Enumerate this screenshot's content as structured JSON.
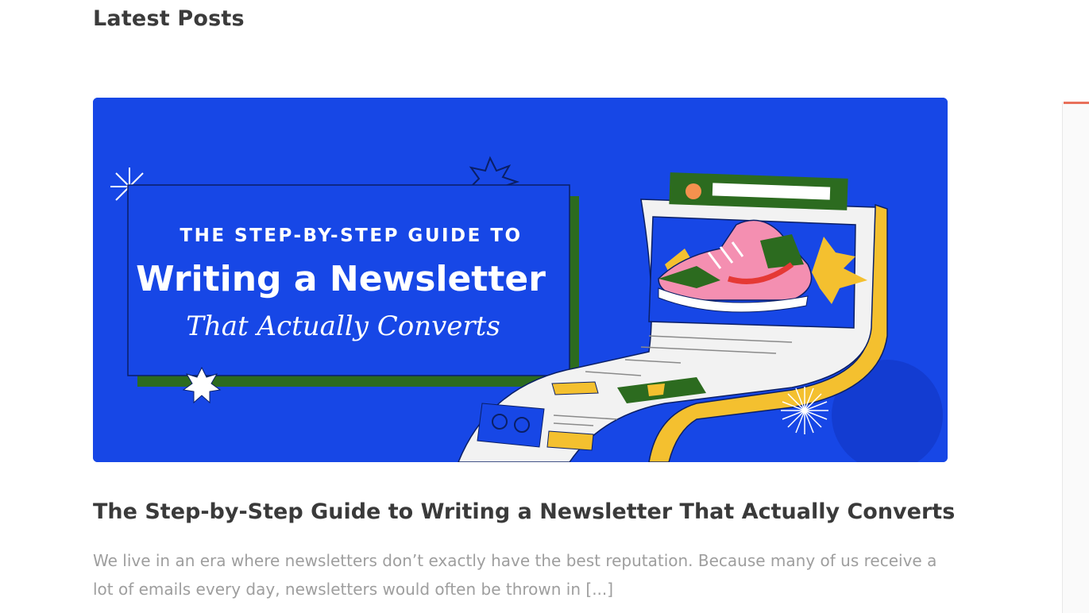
{
  "section": {
    "title": "Latest Posts"
  },
  "post": {
    "image": {
      "line1": "THE STEP-BY-STEP GUIDE TO",
      "line2": "Writing a Newsletter",
      "line3": "That Actually Converts"
    },
    "title": "The Step-by-Step Guide to Writing a Newsletter That Actually Converts",
    "excerpt": "We live in an era where newsletters don’t exactly have the best reputation. Because many of us receive a lot of emails every day, newsletters would often be thrown in [...]"
  },
  "colors": {
    "hero_background": "#1747e6",
    "accent_green": "#2c6b1f",
    "accent_yellow": "#f4c02f",
    "accent_pink": "#f48fb1",
    "side_accent": "#e8705a",
    "title_text": "#3a3a3a",
    "excerpt_text": "#9e9e9e"
  }
}
